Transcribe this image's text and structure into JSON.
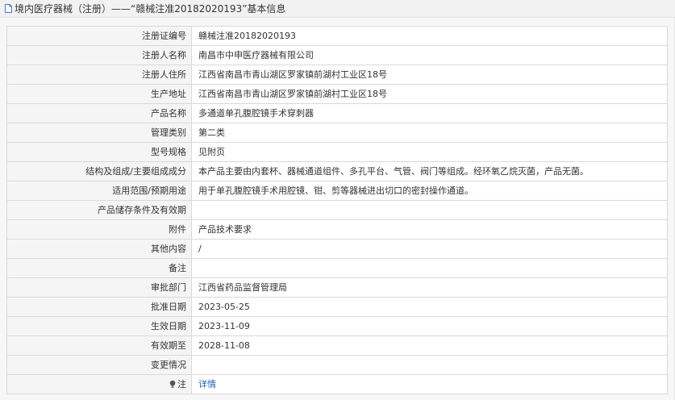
{
  "header": {
    "title": "境内医疗器械（注册）——“赣械注准20182020193”基本信息"
  },
  "rows": [
    {
      "label": "注册证编号",
      "value": "赣械注准20182020193"
    },
    {
      "label": "注册人名称",
      "value": "南昌市中申医疗器械有限公司"
    },
    {
      "label": "注册人住所",
      "value": "江西省南昌市青山湖区罗家镇前湖村工业区18号"
    },
    {
      "label": "生产地址",
      "value": "江西省南昌市青山湖区罗家镇前湖村工业区18号"
    },
    {
      "label": "产品名称",
      "value": "多通道单孔腹腔镜手术穿刺器"
    },
    {
      "label": "管理类别",
      "value": "第二类"
    },
    {
      "label": "型号规格",
      "value": "见附页"
    },
    {
      "label": "结构及组成/主要组成成分",
      "value": "本产品主要由内套杯、器械通道组件、多孔平台、气管、阀门等组成。经环氧乙烷灭菌，产品无菌。"
    },
    {
      "label": "适用范围/预期用途",
      "value": "用于单孔腹腔镜手术用腔镜、钳、剪等器械进出切口的密封操作通道。"
    },
    {
      "label": "产品储存条件及有效期",
      "value": ""
    },
    {
      "label": "附件",
      "value": "产品技术要求"
    },
    {
      "label": "其他内容",
      "value": "/"
    },
    {
      "label": "备注",
      "value": ""
    },
    {
      "label": "审批部门",
      "value": "江西省药品监督管理局"
    },
    {
      "label": "批准日期",
      "value": "2023-05-25"
    },
    {
      "label": "生效日期",
      "value": "2023-11-09"
    },
    {
      "label": "有效期至",
      "value": "2028-11-08"
    },
    {
      "label": "变更情况",
      "value": ""
    }
  ],
  "note_row": {
    "label": "注",
    "link_text": "详情"
  },
  "colors": {
    "link": "#1f5fb5",
    "label_bg": "#f5f5f5",
    "border": "#d9d9d9"
  }
}
